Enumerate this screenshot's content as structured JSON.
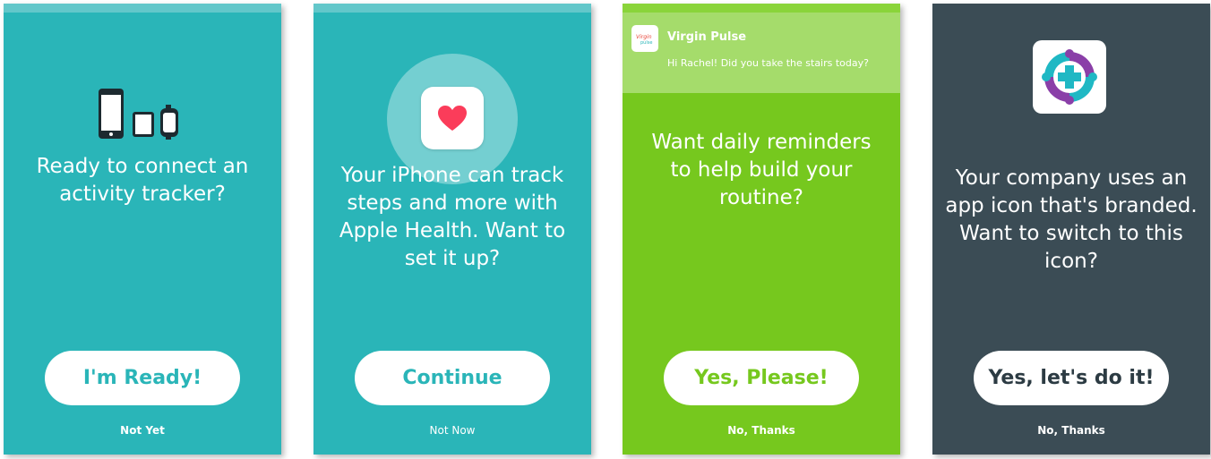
{
  "colors": {
    "teal": "#2ab5b8",
    "teal_strip": "#63c7ca",
    "green": "#76c81e",
    "green_strip": "#8ad43a",
    "green_notification": "#a5dc6b",
    "slate": "#3b4c55",
    "white": "#ffffff"
  },
  "screens": [
    {
      "icon": "devices-icon",
      "prompt": "Ready to connect an\nactivity tracker?",
      "primary_button": "I'm Ready!",
      "secondary_link": "Not Yet"
    },
    {
      "icon": "apple-health-heart-icon",
      "prompt": "Your iPhone can track\nsteps and more with\nApple Health. Want to\nset it up?",
      "primary_button": "Continue",
      "secondary_link": "Not Now"
    },
    {
      "notification": {
        "icon": "virgin-pulse-app-icon",
        "title": "Virgin Pulse",
        "message": "Hi Rachel! Did you take the stairs today?"
      },
      "prompt": "Want daily reminders\nto help build your\nroutine?",
      "primary_button": "Yes, Please!",
      "secondary_link": "No, Thanks"
    },
    {
      "icon": "branded-company-app-icon",
      "prompt": "Your company uses an\napp icon that's branded.\nWant to switch to this\nicon?",
      "primary_button": "Yes, let's do it!",
      "secondary_link": "No, Thanks"
    }
  ]
}
